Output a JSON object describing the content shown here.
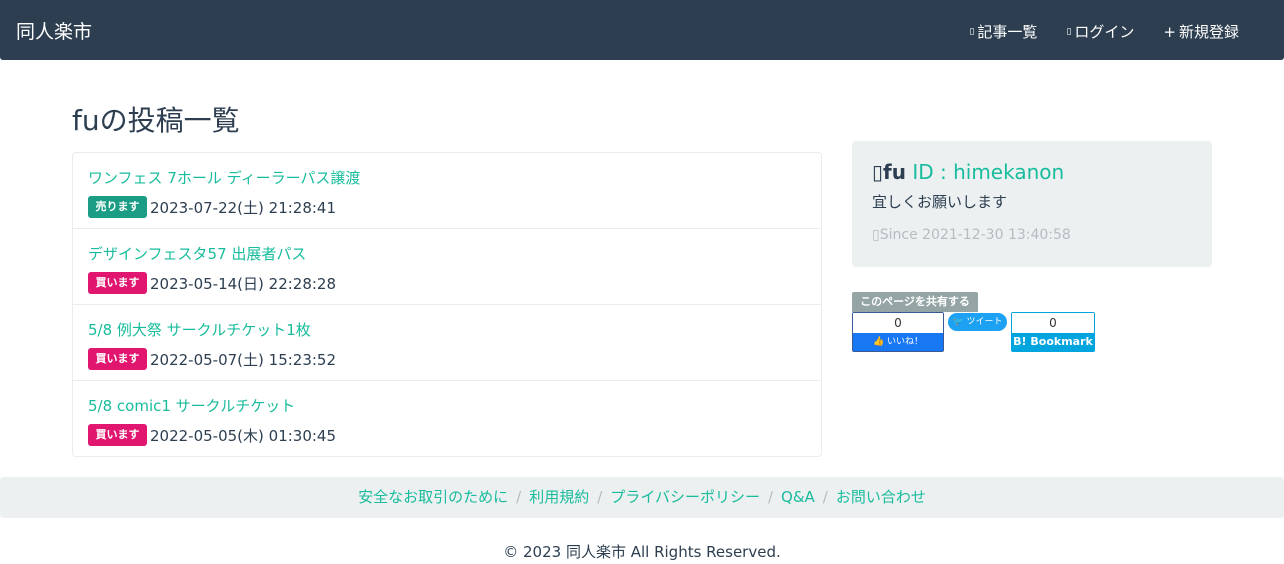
{
  "header": {
    "brand": "同人楽市",
    "nav": [
      {
        "icon": "article-list-icon",
        "glyph": "▯",
        "label": "記事一覧"
      },
      {
        "icon": "login-icon",
        "glyph": "▯",
        "label": "ログイン"
      },
      {
        "icon": "plus-icon",
        "glyph": "+",
        "label": "新規登録"
      }
    ]
  },
  "page": {
    "title": "fuの投稿一覧"
  },
  "posts": [
    {
      "title": "ワンフェス 7ホール ディーラーパス譲渡",
      "badge": "売ります",
      "type": "sell",
      "date": "2023-07-22(土) 21:28:41"
    },
    {
      "title": "デザインフェスタ57 出展者パス",
      "badge": "買います",
      "type": "buy",
      "date": "2023-05-14(日) 22:28:28"
    },
    {
      "title": "5/8 例大祭 サークルチケット1枚",
      "badge": "買います",
      "type": "buy",
      "date": "2022-05-07(土) 15:23:52"
    },
    {
      "title": "5/8 comic1 サークルチケット",
      "badge": "買います",
      "type": "buy",
      "date": "2022-05-05(木) 01:30:45"
    }
  ],
  "profile": {
    "icon_glyph": "▯",
    "name": "fu",
    "id_text": "ID : himekanon",
    "bio": "宜しくお願いします",
    "since_glyph": "▯",
    "since": "Since 2021-12-30 13:40:58"
  },
  "share": {
    "label": "このページを共有する",
    "facebook": {
      "count": "0",
      "label": "いいね！"
    },
    "twitter": {
      "label": "ツイート"
    },
    "hatena": {
      "count": "0",
      "label": "Bookmark",
      "mark": "B!"
    }
  },
  "footer": {
    "links": [
      "安全なお取引のために",
      "利用規約",
      "プライバシーポリシー",
      "Q&A",
      "お問い合わせ"
    ],
    "separator": "/",
    "copyright": "© 2023 同人楽市 All Rights Reserved."
  },
  "colors": {
    "navbar": "#2c3e50",
    "link": "#18bc9c",
    "sell": "#1a9d84",
    "buy": "#e0166f"
  }
}
